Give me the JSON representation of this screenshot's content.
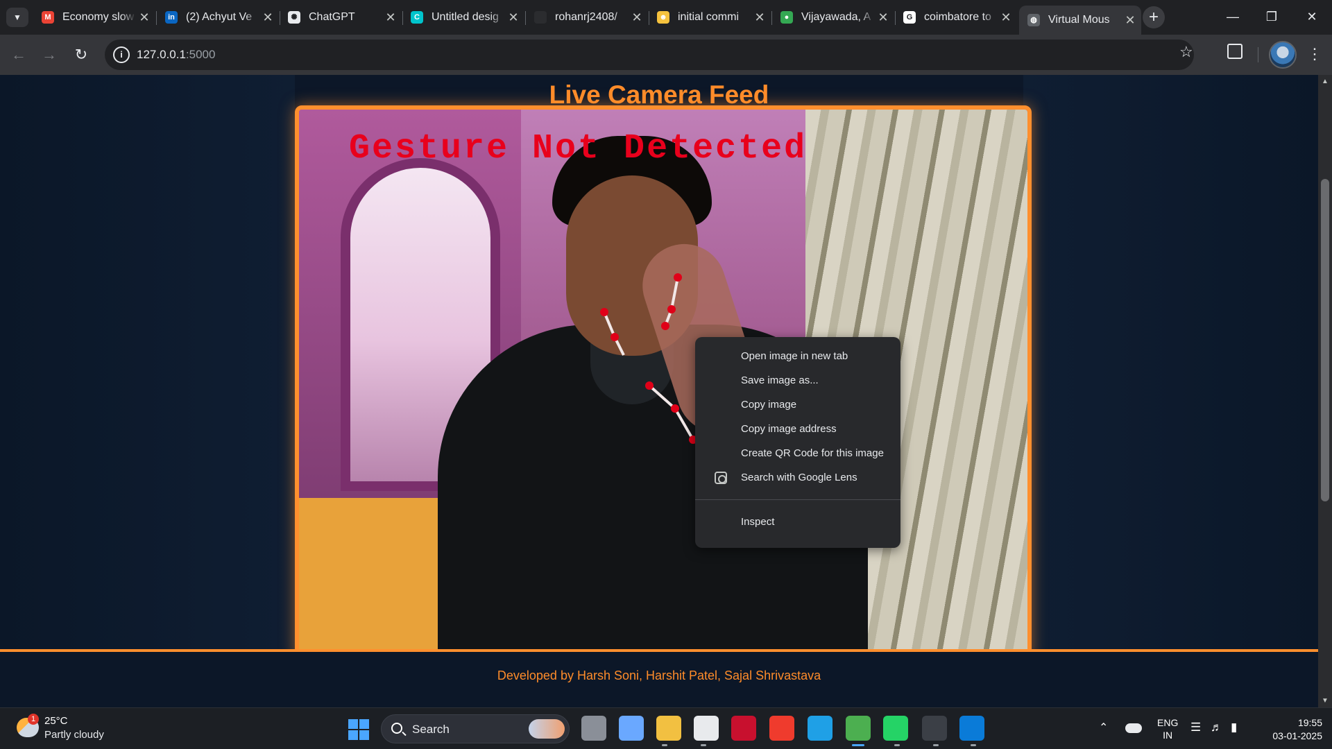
{
  "browser": {
    "tabs": [
      {
        "title": "Economy slow",
        "favicon": "gmail-icon",
        "fav_color": "#ea4335",
        "fav_glyph": "M",
        "active": false
      },
      {
        "title": "(2) Achyut Ve",
        "favicon": "linkedin-icon",
        "fav_color": "#0a66c2",
        "fav_glyph": "in",
        "active": false
      },
      {
        "title": "ChatGPT",
        "favicon": "chatgpt-icon",
        "fav_color": "#e8eaed",
        "fav_glyph": "✺",
        "active": false
      },
      {
        "title": "Untitled desig",
        "favicon": "canva-icon",
        "fav_color": "#00c4cc",
        "fav_glyph": "C",
        "active": false
      },
      {
        "title": "rohanrj2408/",
        "favicon": "github-icon",
        "fav_color": "#2b2c2f",
        "fav_glyph": "",
        "active": false
      },
      {
        "title": "initial commi",
        "favicon": "emoji-icon",
        "fav_color": "#f6c23e",
        "fav_glyph": "☻",
        "active": false
      },
      {
        "title": "Vijayawada, A",
        "favicon": "maps-pin-icon",
        "fav_color": "#34a853",
        "fav_glyph": "●",
        "active": false
      },
      {
        "title": "coimbatore to",
        "favicon": "google-icon",
        "fav_color": "#ffffff",
        "fav_glyph": "G",
        "active": false
      },
      {
        "title": "Virtual Mous",
        "favicon": "globe-icon",
        "fav_color": "#5f6368",
        "fav_glyph": "◍",
        "active": true
      }
    ],
    "url_host": "127.0.0.1",
    "url_port": ":5000"
  },
  "page": {
    "title": "Live Camera Feed",
    "overlay_text": "Gesture Not Detected",
    "footer": "Developed by Harsh Soni, Harshit Patel, Sajal Shrivastava"
  },
  "context_menu": {
    "items": [
      {
        "label": "Open image in new tab"
      },
      {
        "label": "Save image as..."
      },
      {
        "label": "Copy image"
      },
      {
        "label": "Copy image address"
      },
      {
        "label": "Create QR Code for this image"
      },
      {
        "label": "Search with Google Lens",
        "icon": "google-lens-icon"
      }
    ],
    "footer_item": "Inspect"
  },
  "taskbar": {
    "weather_badge": "1",
    "weather_temp": "25°C",
    "weather_desc": "Partly cloudy",
    "search_placeholder": "Search",
    "apps": [
      {
        "name": "task-view-icon",
        "color": "#8a8f98"
      },
      {
        "name": "copilot-icon",
        "color": "#6aa8ff"
      },
      {
        "name": "file-explorer-icon",
        "color": "#f2c041"
      },
      {
        "name": "microsoft-store-icon",
        "color": "#e8eaed"
      },
      {
        "name": "mcafee-icon",
        "color": "#c8102e"
      },
      {
        "name": "anydesk-icon",
        "color": "#ef3b2d"
      },
      {
        "name": "edge-icon",
        "color": "#1fa0e6"
      },
      {
        "name": "chrome-icon",
        "color": "#4caf50"
      },
      {
        "name": "whatsapp-icon",
        "color": "#25d366"
      },
      {
        "name": "terminal-icon",
        "color": "#3b3f46"
      },
      {
        "name": "vscode-icon",
        "color": "#0a7bd8"
      }
    ],
    "lang_line1": "ENG",
    "lang_line2": "IN",
    "time": "19:55",
    "date": "03-01-2025"
  }
}
